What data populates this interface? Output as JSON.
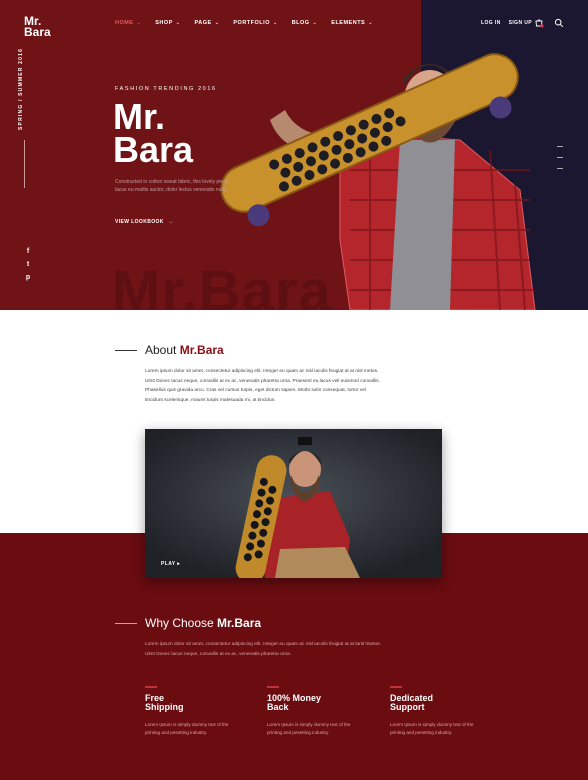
{
  "brand": {
    "logo_line1": "Mr.",
    "logo_line2": "Bara"
  },
  "nav": {
    "items": [
      {
        "label": "HOME",
        "active": true
      },
      {
        "label": "SHOP"
      },
      {
        "label": "PAGE"
      },
      {
        "label": "PORTFOLIO"
      },
      {
        "label": "BLOG"
      },
      {
        "label": "ELEMENTS"
      }
    ],
    "login": "LOG IN",
    "signup": "SIGN UP"
  },
  "hero": {
    "vertical_text": "SPRING / SUMMER 2016",
    "kicker": "FASHION TRENDING 2016",
    "title_line1": "Mr.",
    "title_line2": "Bara",
    "description": "Constructed in cotton sweat fabric, this lovely piece, lacus eu mattis auctor, dolor lectus venenatis nulla.",
    "cta": "VIEW LOOKBOOK",
    "watermark": "Mr.Bara"
  },
  "social": [
    "f",
    "t",
    "p"
  ],
  "about": {
    "title_prefix": "About ",
    "title_brand": "Mr.Bara",
    "body": "Lorem ipsum dolor sit amet, consectetur adipiscing elit. Integer eu quam ac nisl iaculis feugiat at at nisl metus. Ulmt Donec lacus neque, convallis at ex ac, venenatis pharetra urna. Praesent eu lacus vell euismod convallis. Phasellus quis gravida arcu. Cras vel cursus turpis, eget dictum sapien. Morbi sulin consequat, tortor vel tincidunt scelerisque, mauris turpis malesuada mi, at tincidun.",
    "play_label": "PLAY"
  },
  "why": {
    "title_prefix": "Why Choose ",
    "title_brand": "Mr.Bara",
    "body": "Lorem ipsum dolor sit amet, consectetur adipiscing elit. Integer eu quam ac nisl iaculis feugiat at at larsl lmetus. Ulmt Donec lacus neque, convallis at ex ac, venenatis pharetra urna."
  },
  "features": [
    {
      "title_line1": "Free",
      "title_line2": "Shipping",
      "desc": "Lorem Ipsum is simply dummy text of the printing and pesetting industry."
    },
    {
      "title_line1": "100% Money",
      "title_line2": "Back",
      "desc": "Lorem Ipsum is simply dummy text of the printing and pesetting industry."
    },
    {
      "title_line1": "Dedicated",
      "title_line2": "Support",
      "desc": "Lorem Ipsum is simply dummy text of the printing and pesetting industry."
    }
  ],
  "colors": {
    "primary": "#6f1317",
    "accent": "#c0323a",
    "dark": "#1c1730"
  }
}
